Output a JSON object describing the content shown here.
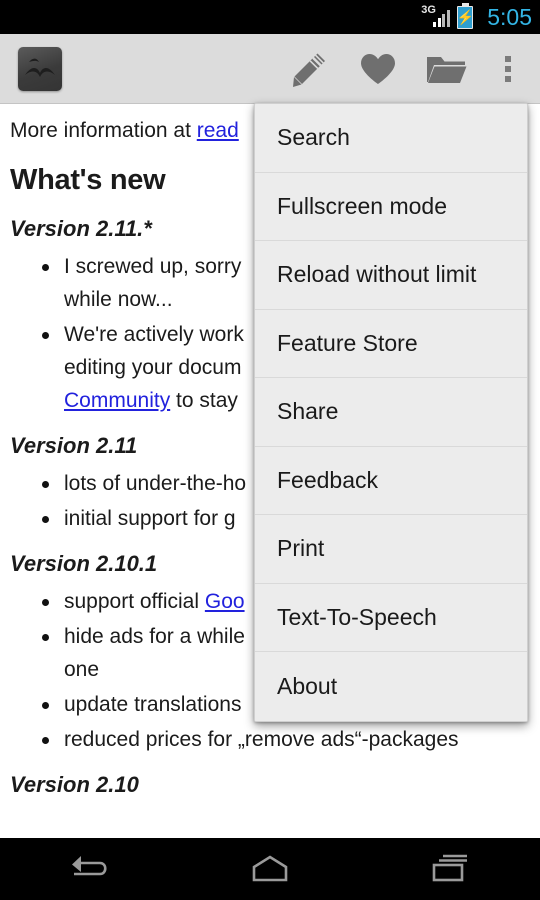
{
  "status_bar": {
    "network_label": "3G",
    "clock": "5:05",
    "icons": [
      "signal-icon",
      "battery-charging-icon"
    ],
    "clock_color": "#33b5e5",
    "background": "#000000"
  },
  "action_bar": {
    "background": "#dcdcdc",
    "app_icon": "book-app-icon",
    "buttons": [
      {
        "name": "edit-button",
        "icon": "pencil-icon",
        "label": "Edit"
      },
      {
        "name": "favorite-button",
        "icon": "heart-icon",
        "label": "Favorite"
      },
      {
        "name": "open-file-button",
        "icon": "folder-icon",
        "label": "Open"
      },
      {
        "name": "overflow-button",
        "icon": "overflow-dots-icon",
        "label": "More options"
      }
    ]
  },
  "document": {
    "lead_prefix": "More information at ",
    "lead_link": "read",
    "heading": "What's new",
    "sections": [
      {
        "version": "Version 2.11.*",
        "items": [
          {
            "line1": "I screwed up, sorry",
            "line2": "while now..."
          },
          {
            "line1": "We're actively work",
            "line2": "editing your docum",
            "link": "Community",
            "line3_after": " to stay"
          }
        ]
      },
      {
        "version": "Version 2.11",
        "items": [
          {
            "line1": "lots of under-the-ho"
          },
          {
            "line1": "initial support for g"
          }
        ]
      },
      {
        "version": "Version 2.10.1",
        "items": [
          {
            "line1": "support official ",
            "link": "Goo"
          },
          {
            "line1": "hide ads for a while",
            "line2": "one"
          },
          {
            "line1": "update translations"
          },
          {
            "line1": "reduced prices for „remove ads“-packages"
          }
        ]
      },
      {
        "version": "Version 2.10",
        "items": []
      }
    ],
    "link_color": "#2222dd"
  },
  "overflow_menu": {
    "background": "#ececec",
    "items": [
      {
        "label": "Search"
      },
      {
        "label": "Fullscreen mode"
      },
      {
        "label": "Reload without limit"
      },
      {
        "label": "Feature Store"
      },
      {
        "label": "Share"
      },
      {
        "label": "Feedback"
      },
      {
        "label": "Print"
      },
      {
        "label": "Text-To-Speech"
      },
      {
        "label": "About"
      }
    ]
  },
  "nav_bar": {
    "background": "#000000",
    "buttons": [
      {
        "name": "back-button",
        "icon": "back-arrow-icon",
        "label": "Back"
      },
      {
        "name": "home-button",
        "icon": "home-icon",
        "label": "Home"
      },
      {
        "name": "recents-button",
        "icon": "recents-icon",
        "label": "Recent apps"
      }
    ]
  }
}
